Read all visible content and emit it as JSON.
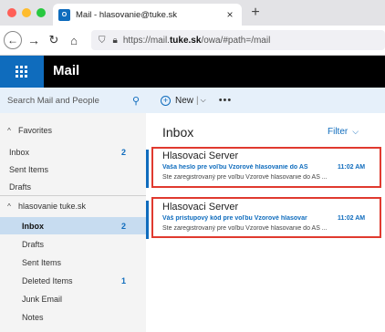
{
  "browser": {
    "tab_title": "Mail - hlasovanie@tuke.sk",
    "tab_close": "×",
    "new_tab": "+",
    "url_prefix": "https://mail.",
    "url_domain": "tuke.sk",
    "url_path": "/owa/#path=/mail"
  },
  "header": {
    "app_title": "Mail"
  },
  "search": {
    "placeholder": "Search Mail and People"
  },
  "commands": {
    "new_label": "New",
    "separator": "|",
    "more": "•••"
  },
  "favorites": {
    "label": "Favorites",
    "items": [
      {
        "label": "Inbox",
        "count": "2"
      },
      {
        "label": "Sent Items",
        "count": ""
      },
      {
        "label": "Drafts",
        "count": ""
      }
    ]
  },
  "account": {
    "label": "hlasovanie tuke.sk",
    "items": [
      {
        "label": "Inbox",
        "count": "2"
      },
      {
        "label": "Drafts",
        "count": ""
      },
      {
        "label": "Sent Items",
        "count": ""
      },
      {
        "label": "Deleted Items",
        "count": "1"
      },
      {
        "label": "Junk Email",
        "count": ""
      },
      {
        "label": "Notes",
        "count": ""
      }
    ]
  },
  "list": {
    "title": "Inbox",
    "filter_label": "Filter",
    "messages": [
      {
        "sender": "Hlasovaci Server",
        "subject": "Vaša heslo pre voľbu Vzorové hlasovanie do AS",
        "time": "11:02 AM",
        "preview": "Ste zaregistrovaný pre voľbu  Vzorové hlasovanie do AS ..."
      },
      {
        "sender": "Hlasovaci Server",
        "subject": "Váš prístupový kód pre voľbu Vzorové hlasovar",
        "time": "11:02 AM",
        "preview": "Ste zaregistrovaný pre voľbu  Vzorové hlasovanie do AS ..."
      }
    ]
  },
  "colors": {
    "accent": "#0f6cbd",
    "highlight": "#e03a2f",
    "header_bg": "#000000"
  }
}
